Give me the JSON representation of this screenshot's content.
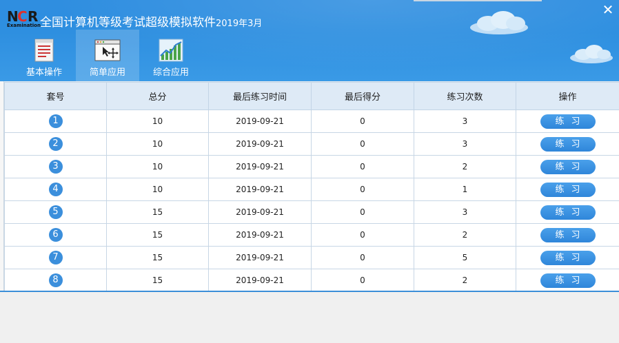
{
  "app": {
    "logo_letters": [
      "N",
      "C",
      "R"
    ],
    "logo_subtext": "Examination",
    "title": "全国计算机等级考试超级模拟软件",
    "title_suffix": "2019年3月",
    "close_glyph": "✕"
  },
  "tabs": [
    {
      "label": "基本操作",
      "icon": "document-icon",
      "active": false
    },
    {
      "label": "简单应用",
      "icon": "window-move-icon",
      "active": true
    },
    {
      "label": "综合应用",
      "icon": "chart-icon",
      "active": false
    }
  ],
  "table": {
    "columns": [
      "套号",
      "总分",
      "最后练习时间",
      "最后得分",
      "练习次数",
      "操作"
    ],
    "rows": [
      {
        "no": "1",
        "score": "10",
        "date": "2019-09-21",
        "last": "0",
        "count": "3",
        "action": "练习"
      },
      {
        "no": "2",
        "score": "10",
        "date": "2019-09-21",
        "last": "0",
        "count": "3",
        "action": "练习"
      },
      {
        "no": "3",
        "score": "10",
        "date": "2019-09-21",
        "last": "0",
        "count": "2",
        "action": "练习"
      },
      {
        "no": "4",
        "score": "10",
        "date": "2019-09-21",
        "last": "0",
        "count": "1",
        "action": "练习"
      },
      {
        "no": "5",
        "score": "15",
        "date": "2019-09-21",
        "last": "0",
        "count": "3",
        "action": "练习"
      },
      {
        "no": "6",
        "score": "15",
        "date": "2019-09-21",
        "last": "0",
        "count": "2",
        "action": "练习"
      },
      {
        "no": "7",
        "score": "15",
        "date": "2019-09-21",
        "last": "0",
        "count": "5",
        "action": "练习"
      },
      {
        "no": "8",
        "score": "15",
        "date": "2019-09-21",
        "last": "0",
        "count": "2",
        "action": "练习"
      }
    ]
  },
  "colors": {
    "header_blue": "#2f8ee0",
    "badge_blue": "#3b8fdc",
    "button_blue": "#3a92de",
    "logo_red": "#e0302a"
  }
}
